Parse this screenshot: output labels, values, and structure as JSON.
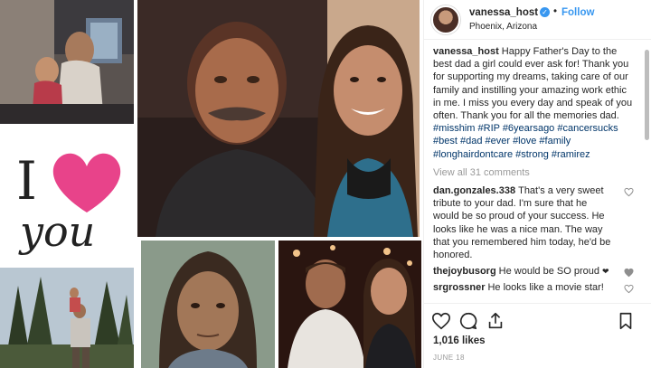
{
  "collage": {
    "i_love_you_text": "I",
    "you_text": "you"
  },
  "post": {
    "username": "vanessa_host",
    "follow_separator": "•",
    "follow_label": "Follow",
    "location": "Phoenix, Arizona",
    "caption_text": "Happy Father's Day to the best dad a girl could ever ask for! Thank you for supporting my dreams, taking care of our family and instilling your amazing work ethic in me. I miss you every day and speak of you often. Thank you for all the memories dad.",
    "hashtags": "#misshim #RIP #6yearsago #cancersucks #best #dad #ever #love #family #longhairdontcare #strong #ramirez",
    "view_all_comments": "View all 31 comments",
    "comments": [
      {
        "user": "dan.gonzales.338",
        "text": "That's a very sweet tribute to your dad. I'm sure that he would be so proud of your success. He looks like he was a nice man. The way that you remembered him today, he'd be honored.",
        "liked": false
      },
      {
        "user": "thejoybusorg",
        "text": "He would be SO proud",
        "liked": true,
        "emoji": "❤"
      },
      {
        "user": "srgrossner",
        "text": "He looks like a movie star!",
        "liked": false
      }
    ],
    "likes": "1,016 likes",
    "date": "JUNE 18"
  },
  "icons": {
    "verified": "verified-badge-icon",
    "like": "heart-icon",
    "comment": "comment-icon",
    "share": "share-icon",
    "save": "bookmark-icon"
  },
  "colors": {
    "link_blue": "#3897f0",
    "hashtag": "#003569",
    "muted": "#999999",
    "heart_pink": "#e8438a"
  }
}
